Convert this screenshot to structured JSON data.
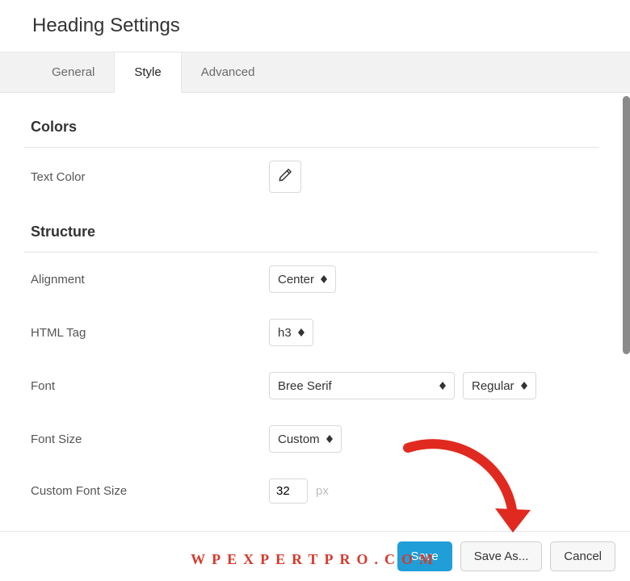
{
  "title": "Heading Settings",
  "tabs": {
    "general": "General",
    "style": "Style",
    "advanced": "Advanced"
  },
  "sections": {
    "colors": {
      "title": "Colors",
      "text_color_label": "Text Color"
    },
    "structure": {
      "title": "Structure",
      "alignment": {
        "label": "Alignment",
        "value": "Center"
      },
      "html_tag": {
        "label": "HTML Tag",
        "value": "h3"
      },
      "font": {
        "label": "Font",
        "family": "Bree Serif",
        "weight": "Regular"
      },
      "font_size": {
        "label": "Font Size",
        "value": "Custom"
      },
      "custom_font_size": {
        "label": "Custom Font Size",
        "value": "32",
        "unit": "px"
      }
    }
  },
  "footer": {
    "save": "Save",
    "save_as": "Save As...",
    "cancel": "Cancel"
  },
  "watermark": "WPEXPERTPRO.COM"
}
